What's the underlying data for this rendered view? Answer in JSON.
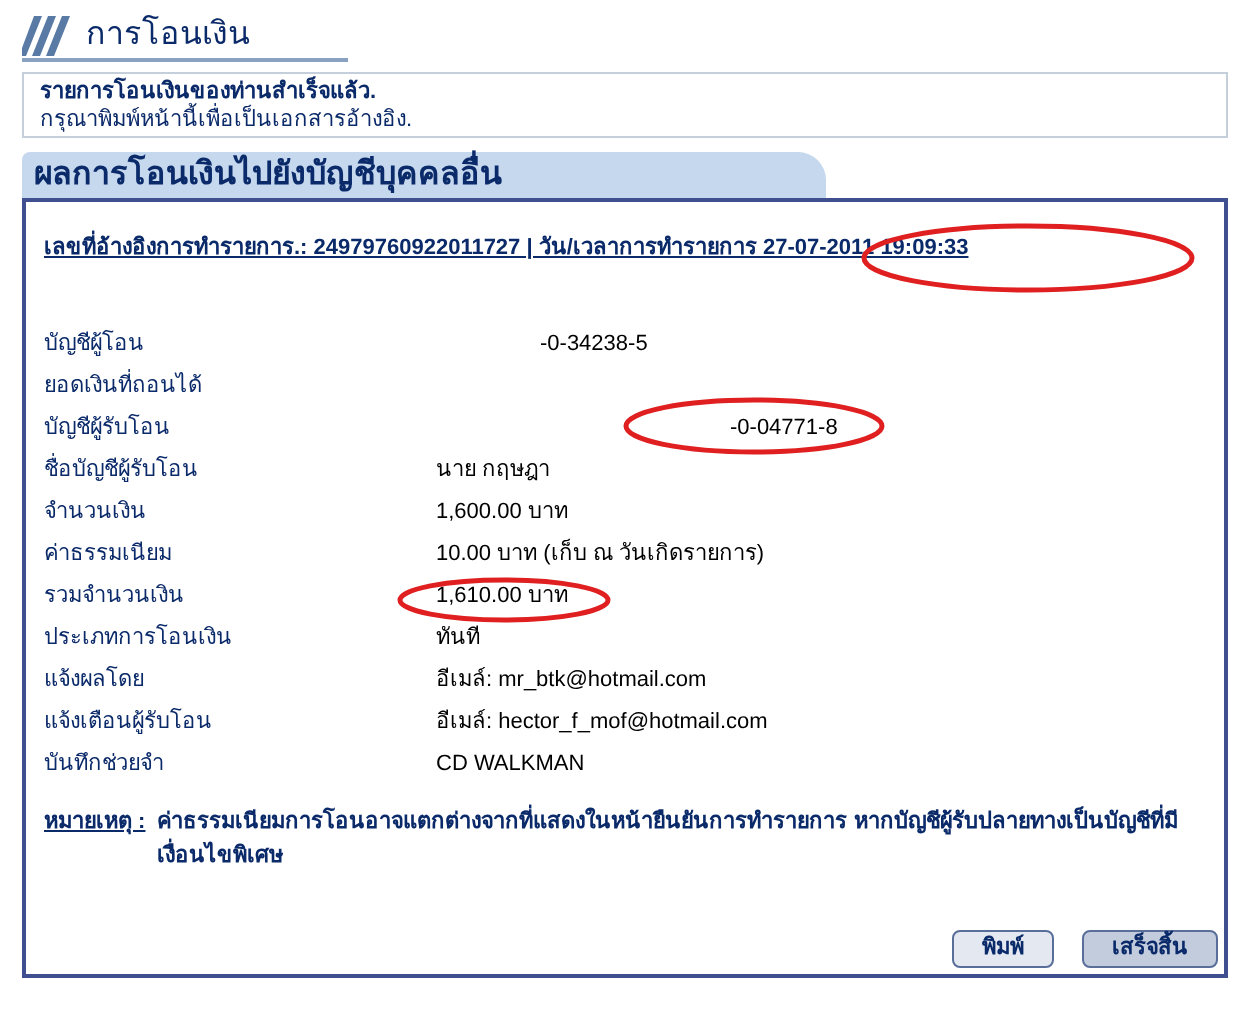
{
  "page_title": "การโอนเงิน",
  "notice": {
    "title": "รายการโอนเงินของท่านสำเร็จแล้ว.",
    "subtitle": "กรุณาพิมพ์หน้านี้เพื่อเป็นเอกสารอ้างอิง."
  },
  "panel": {
    "title": "ผลการโอนเงินไปยังบัญชีบุคคลอื่น",
    "reference": "เลขที่อ้างอิงการทำรายการ.: 24979760922011727 | วัน/เวลาการทำรายการ 27-07-2011 19:09:33",
    "rows": [
      {
        "label": "บัญชีผู้โอน",
        "value": "-0-34238-5"
      },
      {
        "label": "ยอดเงินที่ถอนได้"
      },
      {
        "label": "บัญชีผู้รับโอน",
        "value": "-0-04771-8"
      },
      {
        "label": "ชื่อบัญชีผู้รับโอน",
        "value": "นาย กฤษฎา"
      },
      {
        "label": "จำนวนเงิน",
        "value": "1,600.00 บาท"
      },
      {
        "label": "ค่าธรรมเนียม",
        "value": "10.00 บาท  (เก็บ ณ วันเกิดรายการ)"
      },
      {
        "label": "รวมจำนวนเงิน",
        "value": "1,610.00 บาท"
      },
      {
        "label": "ประเภทการโอนเงิน",
        "value": "ทันที"
      },
      {
        "label": "แจ้งผลโดย",
        "value": "อีเมล์: mr_btk@hotmail.com"
      },
      {
        "label": "แจ้งเตือนผู้รับโอน",
        "value": "อีเมล์: hector_f_mof@hotmail.com"
      },
      {
        "label": "บันทึกช่วยจำ",
        "value": "CD WALKMAN"
      }
    ],
    "note_label": "หมายเหตุ :",
    "note": "ค่าธรรมเนียมการโอนอาจแตกต่างจากที่แสดงในหน้ายืนยันการทำรายการ หากบัญชีผู้รับปลายทางเป็นบัญชีที่มีเงื่อนไขพิเศษ",
    "buttons": [
      "พิมพ์",
      "เสร็จสิ้น"
    ]
  }
}
